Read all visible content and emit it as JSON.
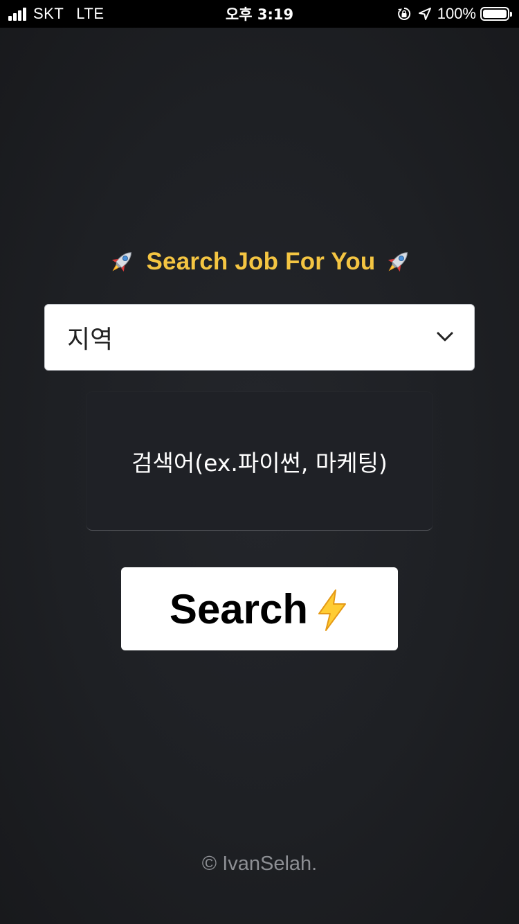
{
  "status_bar": {
    "carrier": "SKT",
    "network": "LTE",
    "time": "오후 3:19",
    "battery_percent": "100%",
    "icons": [
      "signal-bars-icon",
      "orientation-lock-icon",
      "location-arrow-icon",
      "battery-icon"
    ]
  },
  "header": {
    "title": "Search Job For You",
    "title_color": "#f4c542",
    "decor_icon": "rocket-icon"
  },
  "form": {
    "region_select": {
      "selected": "지역",
      "icon": "chevron-down-icon"
    },
    "keyword_input": {
      "placeholder": "검색어(ex.파이썬, 마케팅)",
      "value": ""
    },
    "search_button": {
      "label": "Search",
      "icon": "lightning-bolt-icon"
    }
  },
  "footer": {
    "text": "© IvanSelah."
  },
  "colors": {
    "background": "#1e2024",
    "accent": "#f4c542",
    "button_bg": "#ffffff",
    "footer_text": "#8d8f94"
  }
}
